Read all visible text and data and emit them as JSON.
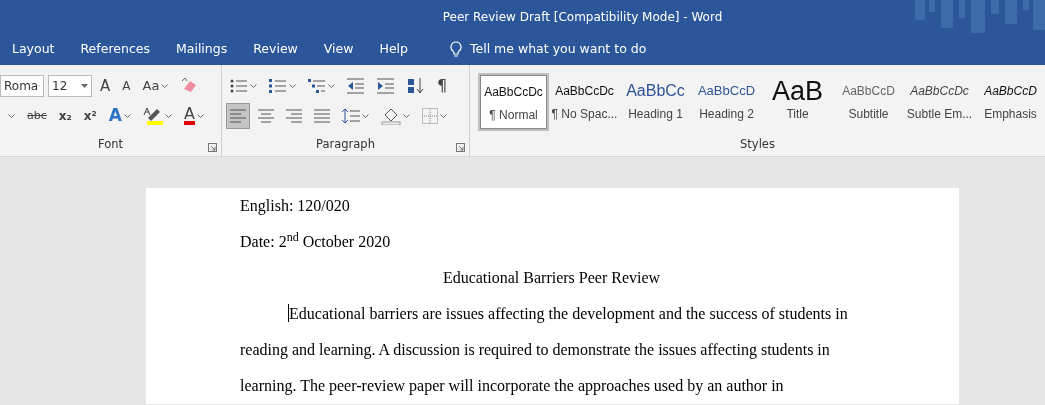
{
  "window": {
    "title": "Peer Review Draft [Compatibility Mode]  -  Word"
  },
  "tabs": [
    {
      "label": "Layout",
      "selected": false
    },
    {
      "label": "References",
      "selected": false
    },
    {
      "label": "Mailings",
      "selected": false
    },
    {
      "label": "Review",
      "selected": false
    },
    {
      "label": "View",
      "selected": false
    },
    {
      "label": "Help",
      "selected": false
    }
  ],
  "tell_me": {
    "placeholder": "Tell me what you want to do"
  },
  "font_group": {
    "label": "Font",
    "font_name": "Roma",
    "font_size": "12",
    "row1": [
      {
        "kind": "grow",
        "glyph": "A",
        "dropdown": false
      },
      {
        "kind": "shrink",
        "glyph": "A",
        "dropdown": false
      },
      {
        "kind": "case",
        "glyph": "Aa",
        "dropdown": true
      },
      {
        "kind": "clear",
        "dropdown": false
      }
    ],
    "row2": [
      {
        "kind": "caret",
        "dropdown": true
      },
      {
        "kind": "strike",
        "glyph": "abc",
        "dropdown": false
      },
      {
        "kind": "sub",
        "glyph": "x₂",
        "dropdown": false
      },
      {
        "kind": "sup",
        "glyph": "x²",
        "dropdown": false
      },
      {
        "kind": "effects",
        "glyph": "A",
        "dropdown": true
      },
      {
        "kind": "highlight",
        "dropdown": true,
        "color": "#ffff00"
      },
      {
        "kind": "fontcolor",
        "glyph": "A",
        "dropdown": true,
        "color": "#e00000"
      }
    ]
  },
  "paragraph_group": {
    "label": "Paragraph",
    "row1": [
      {
        "kind": "bullets",
        "dropdown": true
      },
      {
        "kind": "numbering",
        "dropdown": true
      },
      {
        "kind": "multilevel",
        "dropdown": true
      },
      {
        "kind": "outdent",
        "dropdown": false
      },
      {
        "kind": "indent",
        "dropdown": false
      },
      {
        "kind": "sort",
        "dropdown": false
      },
      {
        "kind": "marks",
        "glyph": "¶",
        "dropdown": false
      }
    ],
    "row2": [
      {
        "kind": "left",
        "dropdown": false,
        "selected": true
      },
      {
        "kind": "center",
        "dropdown": false,
        "selected": false
      },
      {
        "kind": "right",
        "dropdown": false,
        "selected": false
      },
      {
        "kind": "justify",
        "dropdown": false,
        "selected": false
      },
      {
        "kind": "spacing",
        "dropdown": true,
        "selected": false
      },
      {
        "kind": "shading",
        "dropdown": true,
        "selected": false
      },
      {
        "kind": "borders",
        "dropdown": true,
        "selected": false
      }
    ]
  },
  "styles_group": {
    "label": "Styles",
    "items": [
      {
        "kind": "normal",
        "sample": "AaBbCcDc",
        "label": "¶ Normal",
        "selected": true
      },
      {
        "kind": "normal",
        "sample": "AaBbCcDc",
        "label": "¶ No Spac...",
        "selected": false
      },
      {
        "kind": "heading1",
        "sample": "AaBbCc",
        "label": "Heading 1",
        "selected": false
      },
      {
        "kind": "heading2",
        "sample": "AaBbCcD",
        "label": "Heading 2",
        "selected": false
      },
      {
        "kind": "title",
        "sample": "AaB",
        "label": "Title",
        "selected": false
      },
      {
        "kind": "subtitle",
        "sample": "AaBbCcD",
        "label": "Subtitle",
        "selected": false
      },
      {
        "kind": "subtle",
        "sample": "AaBbCcDc",
        "label": "Subtle Em...",
        "selected": false
      },
      {
        "kind": "emphasis",
        "sample": "AaBbCcD",
        "label": "Emphasis",
        "selected": false
      }
    ]
  },
  "document": {
    "paragraphs": [
      {
        "kind": "plain",
        "text": "English: 120/020"
      },
      {
        "kind": "plain",
        "text": "Date: 2$^{nd}$ October 2020"
      },
      {
        "kind": "centered",
        "text": "Educational Barriers Peer Review"
      },
      {
        "kind": "indented",
        "text": "Educational barriers are issues affecting the development and the success of students in reading and learning. A discussion is required to demonstrate the issues affecting students in learning. The peer-review paper will incorporate the approaches used by an author in",
        "cursor": true
      }
    ]
  }
}
